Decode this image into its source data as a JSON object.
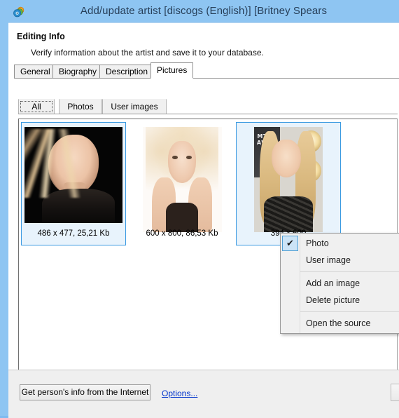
{
  "window": {
    "title": "Add/update artist [discogs (English)] [Britney Spears",
    "icon": "discs-icon",
    "accent_titlebar": "#8ec5f2"
  },
  "header": {
    "heading": "Editing Info",
    "subheading": "Verify information about the artist and save it to your database."
  },
  "tabs": [
    {
      "label": "General",
      "selected": false
    },
    {
      "label": "Biography",
      "selected": false
    },
    {
      "label": "Description",
      "selected": false
    },
    {
      "label": "Pictures",
      "selected": true
    }
  ],
  "subtabs": [
    {
      "label": "All",
      "selected": true
    },
    {
      "label": "Photos",
      "selected": false
    },
    {
      "label": "User images",
      "selected": false
    }
  ],
  "pictures": [
    {
      "label": "486 x 477, 25,21 Kb",
      "selected": true,
      "art": "dark-studio-portrait"
    },
    {
      "label": "600 x 800, 86,53 Kb",
      "selected": false,
      "art": "white-hands-portrait"
    },
    {
      "label": "394 x 600",
      "selected": true,
      "art": "mtv-awards-portrait"
    }
  ],
  "context_menu": {
    "items": [
      {
        "label": "Photo",
        "checked": true,
        "separator_after": false
      },
      {
        "label": "User image",
        "checked": false,
        "separator_after": true
      },
      {
        "label": "Add an image",
        "checked": false,
        "separator_after": false
      },
      {
        "label": "Delete picture",
        "checked": false,
        "separator_after": true
      },
      {
        "label": "Open the source",
        "checked": false,
        "separator_after": false
      }
    ],
    "check_glyph": "✔",
    "highlight_color": "#cce4f7"
  },
  "footer": {
    "get_info_button": "Get person's info from the Internet",
    "options_link": "Options...",
    "back_button": "<<"
  }
}
